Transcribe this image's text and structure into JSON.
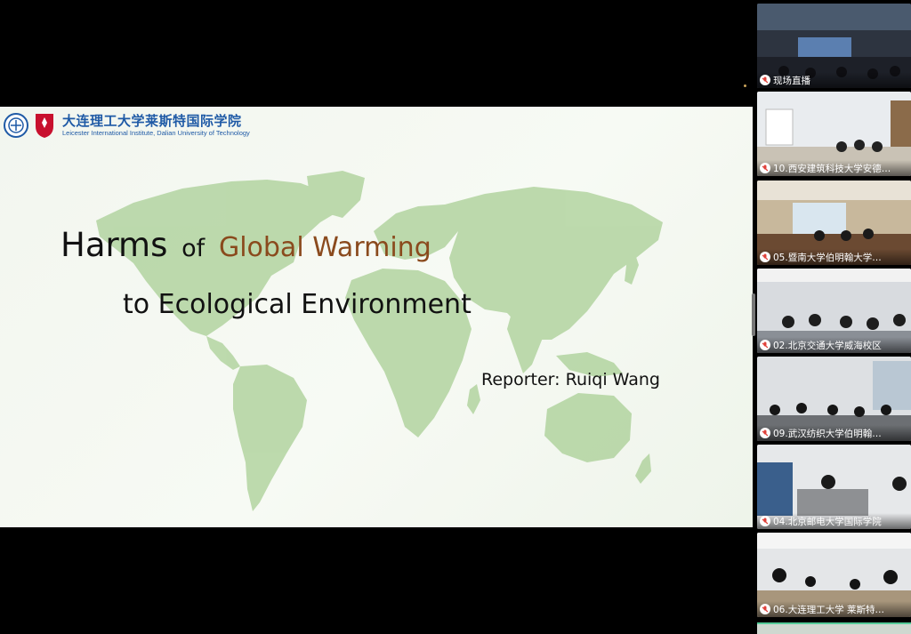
{
  "slide": {
    "logo_cn": "大连理工大学莱斯特国际学院",
    "logo_en": "Leicester International Institute, Dalian University of Technology",
    "title_harms": "Harms",
    "title_of": "of",
    "title_global": "Global Warming",
    "title_line2": "to Ecological Environment",
    "reporter": "Reporter: Ruiqi Wang",
    "accent_color": "#8a4a1d",
    "map_color": "#a9cf95"
  },
  "participants": [
    {
      "name": "现场直播",
      "icon": "mic-muted-icon"
    },
    {
      "name": "10.西安建筑科技大学安德…",
      "icon": "mic-muted-icon"
    },
    {
      "name": "05.暨南大学伯明翰大学…",
      "icon": "mic-muted-icon"
    },
    {
      "name": "02.北京交通大学威海校区",
      "icon": "mic-muted-icon"
    },
    {
      "name": "09.武汉纺织大学伯明翰…",
      "icon": "mic-muted-icon"
    },
    {
      "name": "04.北京邮电大学国际学院",
      "icon": "mic-muted-icon"
    },
    {
      "name": "06.大连理工大学 莱斯特…",
      "icon": "mic-muted-icon"
    }
  ]
}
